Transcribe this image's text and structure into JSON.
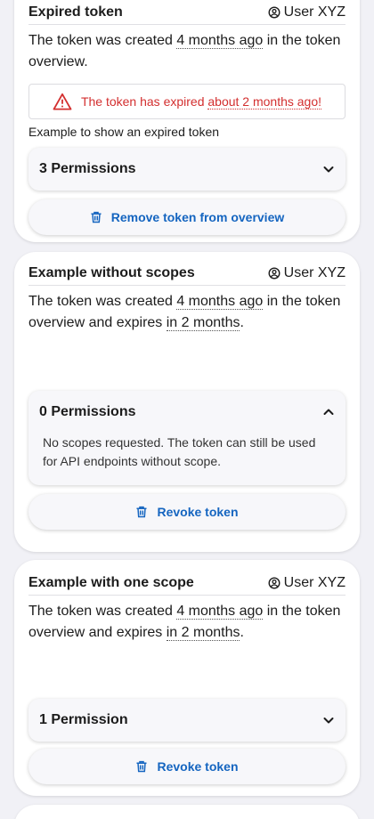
{
  "colors": {
    "link": "#1565c0",
    "error": "#d32f2f"
  },
  "cards": [
    {
      "title": "Expired token",
      "user": "User XYZ",
      "created_prefix": "The token was created ",
      "created_value": "4 months ago",
      "created_suffix": " in the token overview.",
      "alert_prefix": "The token has expired ",
      "alert_value": "about 2 months ago!",
      "caption": "Example to show an expired token",
      "permissions_label": "3 Permissions",
      "action_label": "Remove token from overview"
    },
    {
      "title": "Example without scopes",
      "user": "User XYZ",
      "created_prefix": "The token was created ",
      "created_value": "4 months ago",
      "created_mid": " in the token overview and expires ",
      "expires_value": "in 2 months",
      "created_end": ".",
      "permissions_label": "0 Permissions",
      "permissions_body": "No scopes requested. The token can still be used for API endpoints without scope.",
      "action_label": "Revoke token"
    },
    {
      "title": "Example with one scope",
      "user": "User XYZ",
      "created_prefix": "The token was created ",
      "created_value": "4 months ago",
      "created_mid": " in the token overview and expires ",
      "expires_value": "in 2 months",
      "created_end": ".",
      "permissions_label": "1 Permission",
      "action_label": "Revoke token"
    }
  ]
}
